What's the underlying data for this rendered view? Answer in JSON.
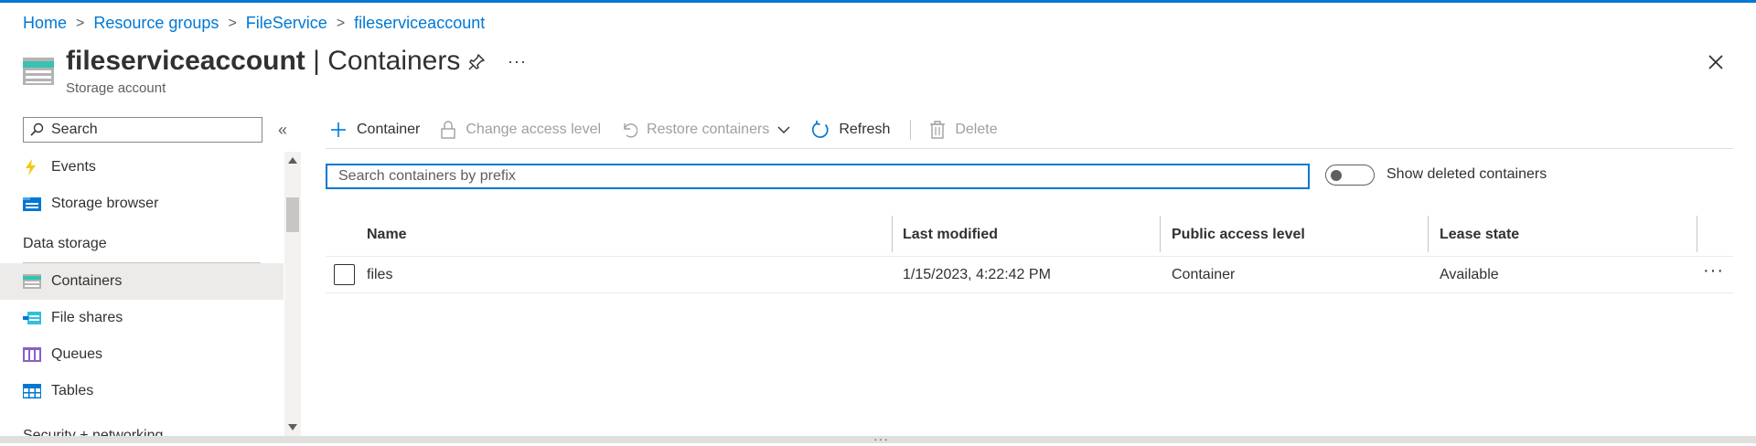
{
  "breadcrumb": {
    "items": [
      "Home",
      "Resource groups",
      "FileService",
      "fileserviceaccount"
    ],
    "separator": ">"
  },
  "header": {
    "title_bold": "fileserviceaccount",
    "title_rest": " | Containers",
    "subtitle": "Storage account",
    "more_label": "···"
  },
  "sidebar": {
    "search_placeholder": "Search",
    "collapse_label": "«",
    "items": {
      "events": "Events",
      "storage_browser": "Storage browser",
      "containers": "Containers",
      "file_shares": "File shares",
      "queues": "Queues",
      "tables": "Tables"
    },
    "sections": {
      "data_storage": "Data storage",
      "security": "Security + networking"
    },
    "active_item": "containers"
  },
  "toolbar": {
    "container": "Container",
    "change_access": "Change access level",
    "restore": "Restore containers",
    "refresh": "Refresh",
    "delete": "Delete"
  },
  "filter": {
    "placeholder": "Search containers by prefix",
    "toggle_label": "Show deleted containers",
    "toggle_on": false
  },
  "table": {
    "columns": [
      "Name",
      "Last modified",
      "Public access level",
      "Lease state"
    ],
    "rows": [
      {
        "name": "files",
        "last_modified": "1/15/2023, 4:22:42 PM",
        "public_access": "Container",
        "lease_state": "Available",
        "more": "···"
      }
    ]
  },
  "splitter_grip": "···",
  "colors": {
    "accent": "#0078d4",
    "text": "#323130",
    "disabled": "#a19f9d"
  }
}
